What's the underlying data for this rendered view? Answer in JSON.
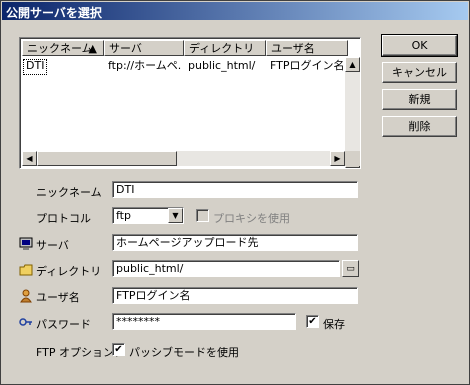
{
  "dialog": {
    "title": "公開サーバを選択"
  },
  "buttons": {
    "ok": "OK",
    "cancel": "キャンセル",
    "new": "新規",
    "delete": "削除"
  },
  "table": {
    "columns": [
      "ニックネーム",
      "サーバ",
      "ディレクトリ",
      "ユーザ名"
    ],
    "rows": [
      {
        "nickname": "DTI",
        "server": "ftp://ホームペ...",
        "directory": "public_html/",
        "user": "FTPログイン名"
      }
    ]
  },
  "form": {
    "nickname_label": "ニックネーム",
    "nickname_value": "DTI",
    "protocol_label": "プロトコル",
    "protocol_value": "ftp",
    "proxy_label": "プロキシを使用",
    "server_label": "サーバ",
    "server_value": "ホームページアップロード先",
    "directory_label": "ディレクトリ",
    "directory_value": "public_html/",
    "username_label": "ユーザ名",
    "username_value": "FTPログイン名",
    "password_label": "パスワード",
    "password_value": "********",
    "save_label": "保存",
    "ftp_option_label": "FTP オプション：",
    "passive_label": "パッシブモードを使用"
  },
  "colors": {
    "title_start": "#0a246a",
    "title_end": "#a6caf0",
    "face": "#d4d0c8"
  },
  "icons": {
    "server": "computer-icon",
    "directory": "folder-icon",
    "user": "user-icon",
    "password": "key-icon"
  }
}
